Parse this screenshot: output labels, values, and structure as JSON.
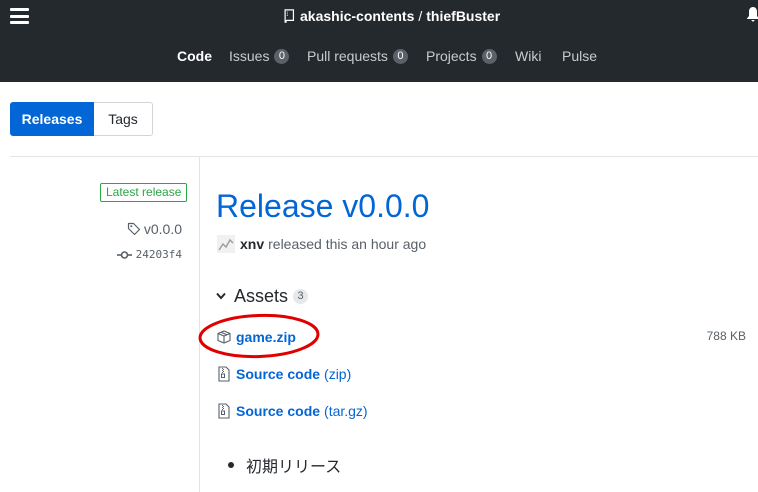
{
  "header": {
    "owner": "akashic-contents",
    "separator": "/",
    "repo": "thiefBuster",
    "nav": [
      {
        "label": "Code",
        "count": null
      },
      {
        "label": "Issues",
        "count": "0"
      },
      {
        "label": "Pull requests",
        "count": "0"
      },
      {
        "label": "Projects",
        "count": "0"
      },
      {
        "label": "Wiki",
        "count": null
      },
      {
        "label": "Pulse",
        "count": null
      }
    ]
  },
  "tabs": {
    "releases": "Releases",
    "tags": "Tags"
  },
  "release": {
    "badge": "Latest release",
    "tag": "v0.0.0",
    "commit": "24203f4",
    "title": "Release v0.0.0",
    "author": "xnv",
    "released_text": "released this an hour ago",
    "assets_label": "Assets",
    "assets_count": "3",
    "assets": [
      {
        "name": "game.zip",
        "suffix": "",
        "size": "788 KB",
        "icon": "package-icon"
      },
      {
        "name": "Source code",
        "suffix": "(zip)",
        "size": "",
        "icon": "file-zip-icon"
      },
      {
        "name": "Source code",
        "suffix": "(tar.gz)",
        "size": "",
        "icon": "file-zip-icon"
      }
    ],
    "notes": [
      "初期リリース"
    ]
  },
  "colors": {
    "header_bg": "#24292e",
    "accent": "#0366d6",
    "badge_green": "#28a745",
    "annotation_red": "#e00000"
  }
}
